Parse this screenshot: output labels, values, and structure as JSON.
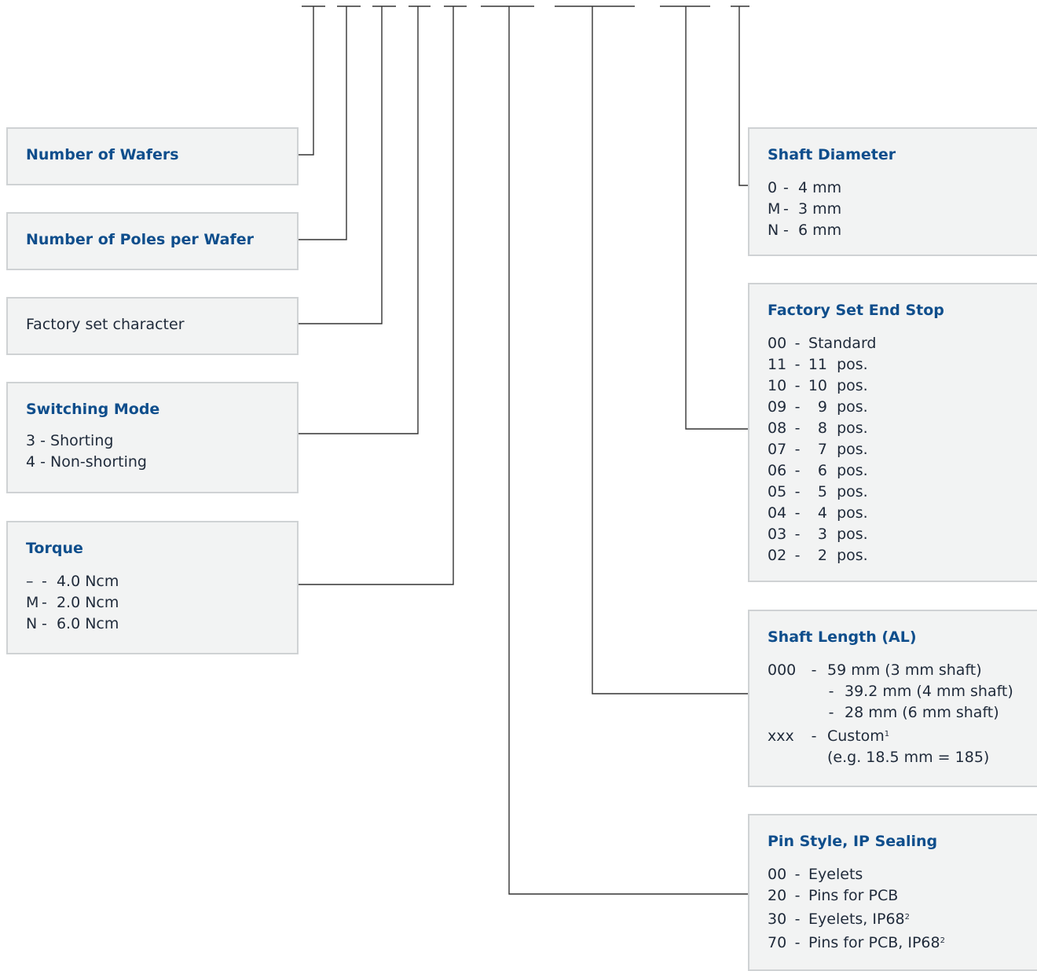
{
  "wafers": {
    "title": "Number of Wafers"
  },
  "poles": {
    "title": "Number of Poles per Wafer"
  },
  "factory_char": {
    "label": "Factory set character"
  },
  "switching": {
    "title": "Switching Mode",
    "options": [
      {
        "code": "3",
        "sep": "-",
        "desc": "Shorting"
      },
      {
        "code": "4",
        "sep": "-",
        "desc": "Non-shorting"
      }
    ]
  },
  "torque": {
    "title": "Torque",
    "options": [
      {
        "code": "–",
        "sep": "-",
        "desc": "4.0 Ncm"
      },
      {
        "code": "M",
        "sep": "-",
        "desc": "2.0 Ncm"
      },
      {
        "code": "N",
        "sep": "-",
        "desc": "6.0 Ncm"
      }
    ]
  },
  "shaft_diameter": {
    "title": "Shaft Diameter",
    "options": [
      {
        "code": "0",
        "sep": "-",
        "desc": "4 mm"
      },
      {
        "code": "M",
        "sep": "-",
        "desc": "3 mm"
      },
      {
        "code": "N",
        "sep": "-",
        "desc": "6 mm"
      }
    ]
  },
  "end_stop": {
    "title": "Factory Set End Stop",
    "options": [
      {
        "code": "00",
        "sep": "-",
        "num": "",
        "desc": "Standard"
      },
      {
        "code": "11",
        "sep": "-",
        "num": "11",
        "desc": "pos."
      },
      {
        "code": "10",
        "sep": "-",
        "num": "10",
        "desc": "pos."
      },
      {
        "code": "09",
        "sep": "-",
        "num": "9",
        "desc": "pos."
      },
      {
        "code": "08",
        "sep": "-",
        "num": "8",
        "desc": "pos."
      },
      {
        "code": "07",
        "sep": "-",
        "num": "7",
        "desc": "pos."
      },
      {
        "code": "06",
        "sep": "-",
        "num": "6",
        "desc": "pos."
      },
      {
        "code": "05",
        "sep": "-",
        "num": "5",
        "desc": "pos."
      },
      {
        "code": "04",
        "sep": "-",
        "num": "4",
        "desc": "pos."
      },
      {
        "code": "03",
        "sep": "-",
        "num": "3",
        "desc": "pos."
      },
      {
        "code": "02",
        "sep": "-",
        "num": "2",
        "desc": "pos."
      }
    ]
  },
  "shaft_length": {
    "title": "Shaft Length (AL)",
    "lines": [
      {
        "code": "000",
        "sep": "-",
        "desc": "59 mm  (3 mm shaft)"
      },
      {
        "code": "",
        "sep": "-",
        "desc": "39.2 mm (4 mm shaft)"
      },
      {
        "code": "",
        "sep": "-",
        "desc": "28 mm (6 mm shaft)"
      },
      {
        "code": "xxx",
        "sep": "-",
        "desc": "Custom",
        "sup": "1"
      },
      {
        "code": "",
        "sep": "",
        "desc": "(e.g. 18.5 mm = 185)"
      }
    ]
  },
  "pin_style": {
    "title": "Pin Style, IP Sealing",
    "options": [
      {
        "code": "00",
        "sep": "-",
        "desc": "Eyelets",
        "sup": ""
      },
      {
        "code": "20",
        "sep": "-",
        "desc": "Pins for PCB",
        "sup": ""
      },
      {
        "code": "30",
        "sep": "-",
        "desc": "Eyelets, IP68",
        "sup": "2"
      },
      {
        "code": "70",
        "sep": "-",
        "desc": "Pins for PCB, IP68",
        "sup": "2"
      }
    ]
  },
  "colors": {
    "title": "#0f4e8c",
    "box_fill": "#f2f3f3",
    "box_border": "#cfd2d4",
    "line": "#333333"
  }
}
